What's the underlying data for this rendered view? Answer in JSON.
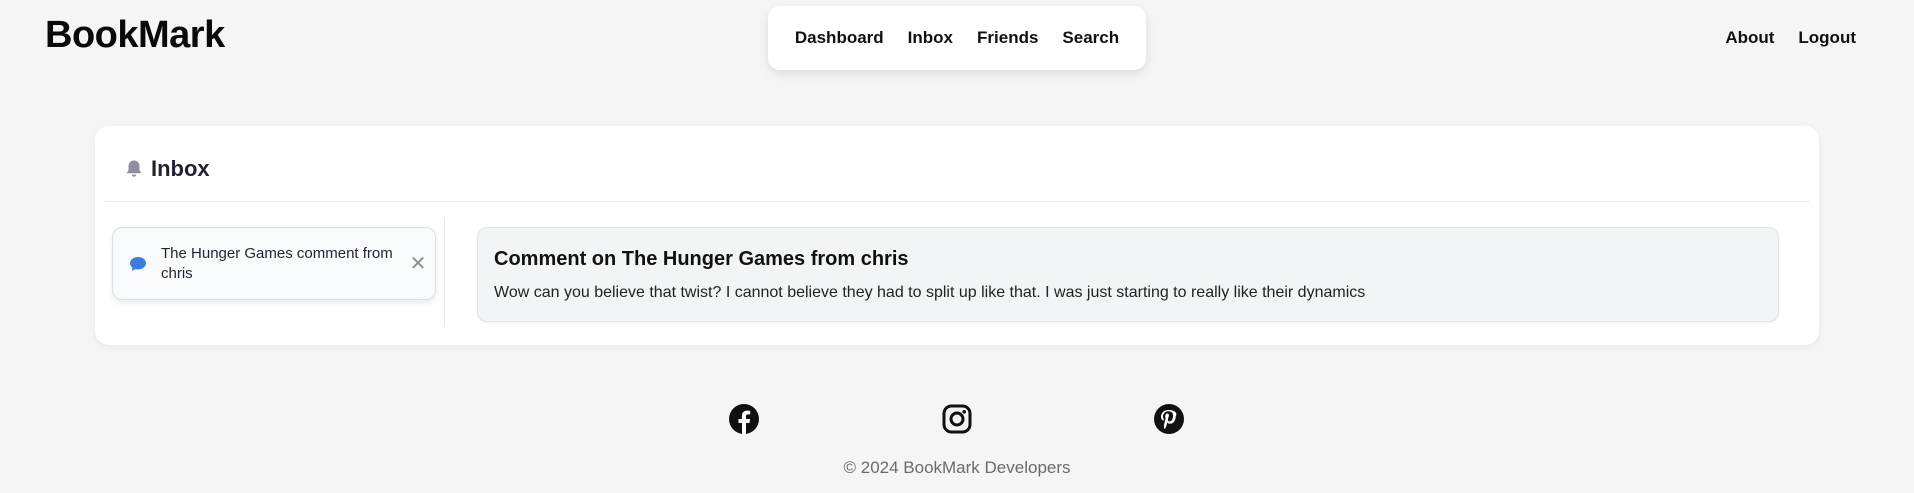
{
  "brand": {
    "name": "BookMark"
  },
  "nav": {
    "main": [
      "Dashboard",
      "Inbox",
      "Friends",
      "Search"
    ],
    "right": [
      "About",
      "Logout"
    ]
  },
  "inbox": {
    "title": "Inbox",
    "icon": "bell-icon",
    "notifications": [
      {
        "icon": "chat-bubble-icon",
        "text": "The Hunger Games comment from chris",
        "close_icon": "close-icon"
      }
    ],
    "selected": {
      "title": "Comment on The Hunger Games from chris",
      "body": "Wow can you believe that twist? I cannot believe they had to split up like that. I was just starting to really like their dynamics"
    }
  },
  "footer": {
    "social": [
      "facebook-icon",
      "instagram-icon",
      "pinterest-icon"
    ],
    "copyright": "© 2024 BookMark Developers"
  },
  "colors": {
    "background": "#f5f5f5",
    "chat_icon": "#3b7ddd"
  }
}
